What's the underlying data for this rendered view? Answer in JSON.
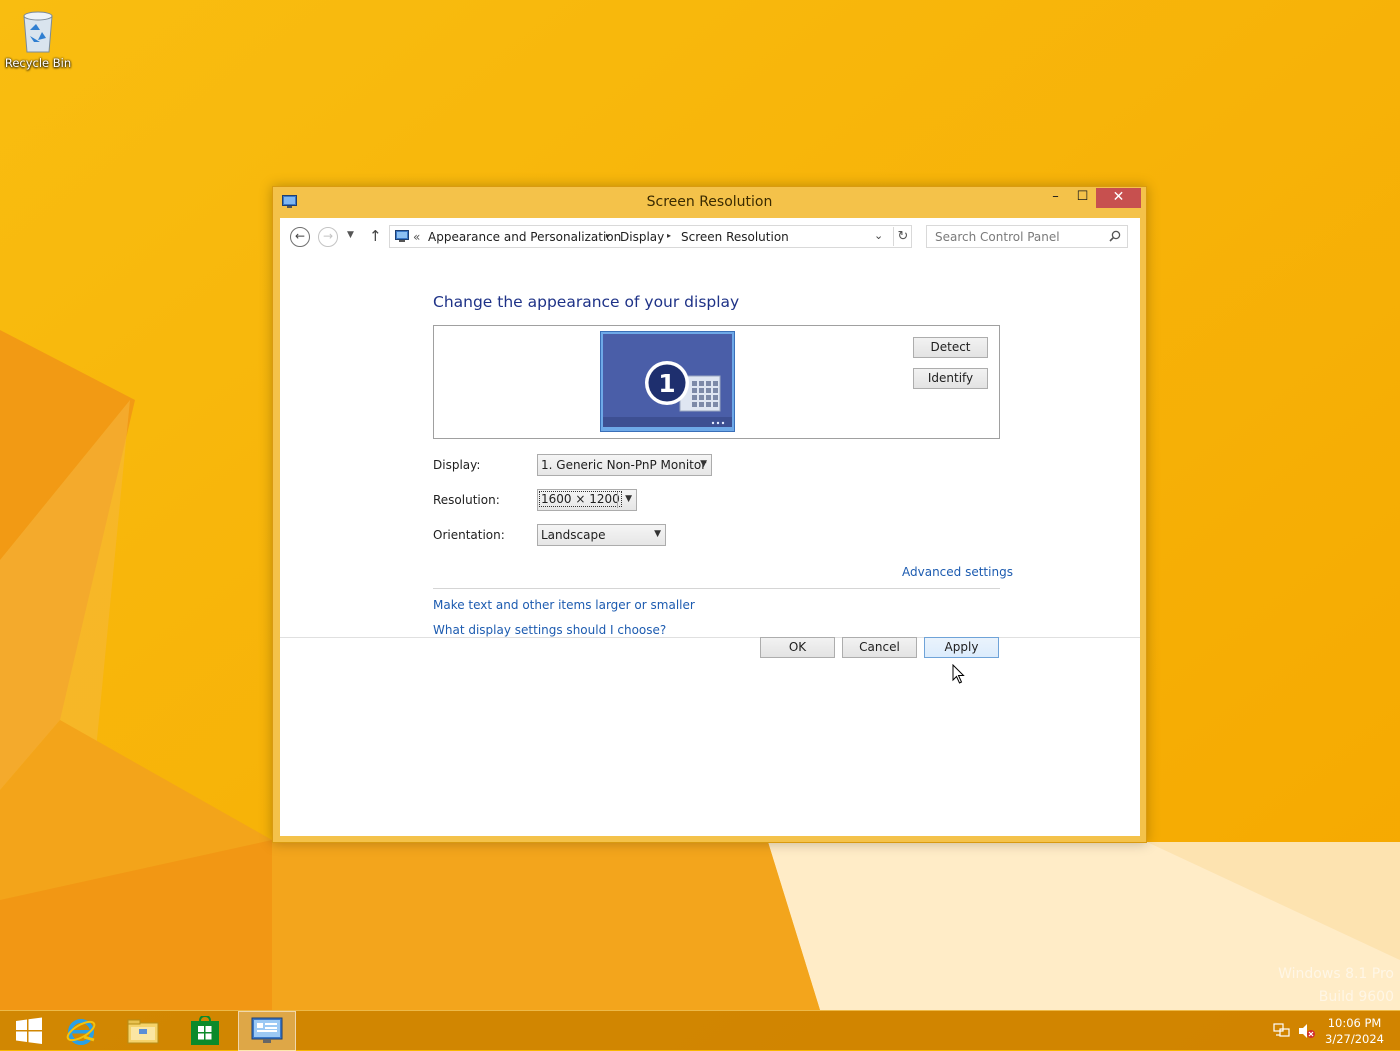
{
  "desktop": {
    "recycle_bin_label": "Recycle Bin",
    "watermark_line1": "Windows 8.1 Pro",
    "watermark_line2": "Build 9600"
  },
  "window": {
    "title": "Screen Resolution",
    "minimize_glyph": "–",
    "maximize_glyph": "☐",
    "close_glyph": "✕"
  },
  "navigation": {
    "back_glyph": "←",
    "forward_glyph": "→",
    "recent_glyph": "▼",
    "up_glyph": "↑",
    "breadcrumb_prefix": "«",
    "breadcrumb": [
      "Appearance and Personalization",
      "Display",
      "Screen Resolution"
    ],
    "separator_glyph": "▸",
    "dropdown_glyph": "⌄",
    "refresh_glyph": "↻",
    "search_placeholder": "Search Control Panel"
  },
  "main": {
    "heading": "Change the appearance of your display",
    "monitor_number": "1",
    "detect_label": "Detect",
    "identify_label": "Identify",
    "display_label": "Display:",
    "display_value": "1. Generic Non-PnP Monitor",
    "resolution_label": "Resolution:",
    "resolution_value": "1600 × 1200",
    "orientation_label": "Orientation:",
    "orientation_value": "Landscape",
    "combo_arrow": "▼",
    "advanced_settings": "Advanced settings",
    "link_text_size": "Make text and other items larger or smaller",
    "link_help": "What display settings should I choose?",
    "ok_label": "OK",
    "cancel_label": "Cancel",
    "apply_label": "Apply"
  },
  "taskbar": {
    "clock_time": "10:06 PM",
    "clock_date": "3/27/2024"
  },
  "colors": {
    "desktop": "#f8b700",
    "heading_blue": "#1e3287",
    "link_blue": "#1c5bb0",
    "close_red": "#c7504f"
  }
}
